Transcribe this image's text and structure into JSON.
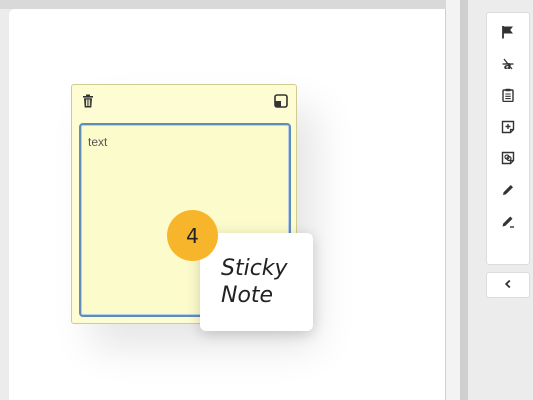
{
  "sticky_note": {
    "textarea_placeholder": "text",
    "delete_icon": "trash-icon",
    "minimize_icon": "minimize-icon"
  },
  "callout": {
    "step_number": "4",
    "line1": "Sticky",
    "line2": "Note"
  },
  "toolbar": {
    "tools": [
      {
        "name": "flag-icon"
      },
      {
        "name": "strikeout-icon"
      },
      {
        "name": "clipboard-icon"
      },
      {
        "name": "add-note-icon"
      },
      {
        "name": "link-note-icon"
      },
      {
        "name": "pencil-icon"
      },
      {
        "name": "edit-pencil-icon"
      }
    ],
    "collapse_icon": "chevron-left-icon"
  },
  "colors": {
    "note_background": "#fdfcd2",
    "note_border": "#cfcc92",
    "textarea_border": "#5f8db8",
    "badge": "#f7b52c"
  }
}
